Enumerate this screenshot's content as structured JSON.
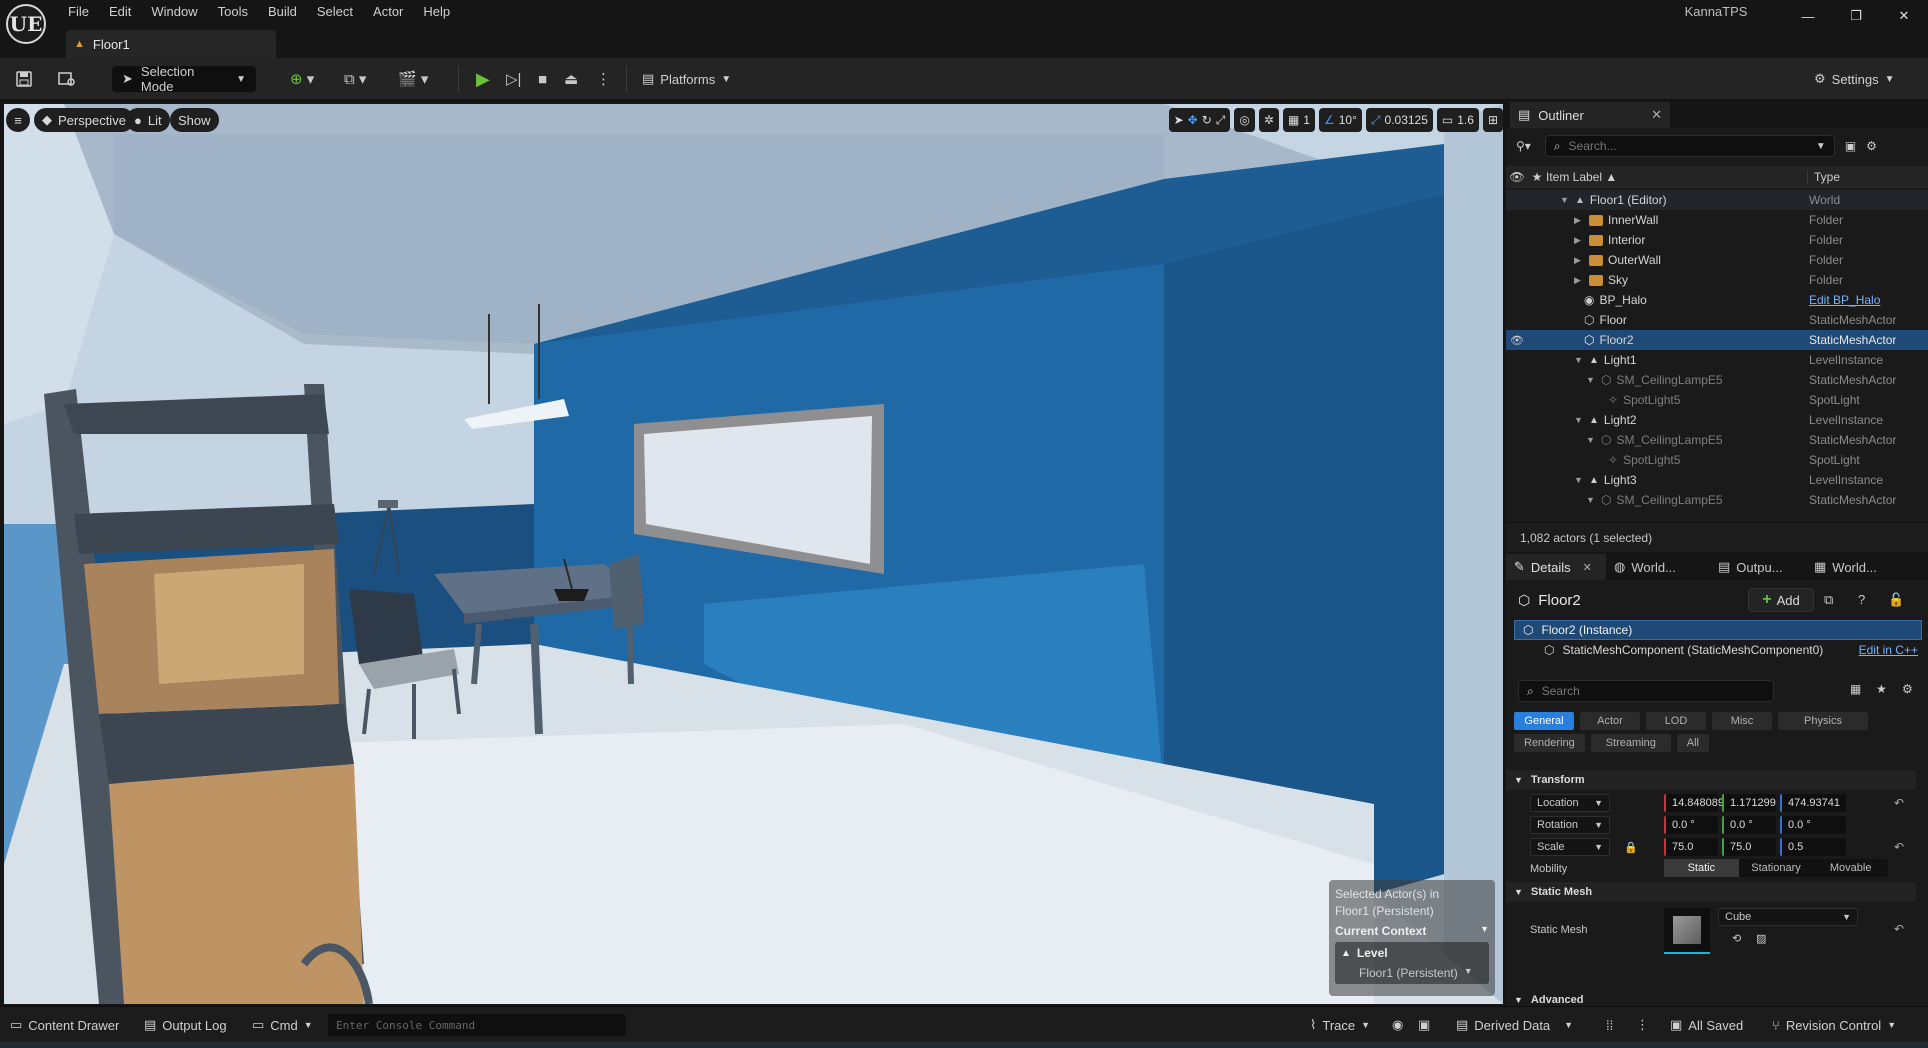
{
  "app": {
    "project_name": "KannaTPS",
    "logo": "UE",
    "doc_tab": "Floor1",
    "window_buttons": [
      "—",
      "❐",
      "✕"
    ]
  },
  "menu": [
    "File",
    "Edit",
    "Window",
    "Tools",
    "Build",
    "Select",
    "Actor",
    "Help"
  ],
  "toolbar": {
    "selection_mode": "Selection Mode",
    "platforms": "Platforms",
    "settings": "Settings"
  },
  "viewport": {
    "perspective": "Perspective",
    "lit": "Lit",
    "show": "Show",
    "grid_value": "1",
    "angle_value": "10°",
    "scale_value": "0.03125",
    "camera_speed": "1.6",
    "context": {
      "selected_text_1": "Selected Actor(s) in",
      "selected_text_2": "Floor1 (Persistent)",
      "title": "Current Context",
      "level_label": "Level",
      "level_name": "Floor1 (Persistent)"
    }
  },
  "outliner": {
    "tab_label": "Outliner",
    "search_placeholder": "Search...",
    "col_label": "Item Label ▲",
    "col_type": "Type",
    "rows": [
      {
        "label": "Floor1 (Editor)",
        "type": "World"
      },
      {
        "label": "InnerWall",
        "type": "Folder"
      },
      {
        "label": "Interior",
        "type": "Folder"
      },
      {
        "label": "OuterWall",
        "type": "Folder"
      },
      {
        "label": "Sky",
        "type": "Folder"
      },
      {
        "label": "BP_Halo",
        "type": "Edit BP_Halo"
      },
      {
        "label": "Floor",
        "type": "StaticMeshActor"
      },
      {
        "label": "Floor2",
        "type": "StaticMeshActor"
      },
      {
        "label": "Light1",
        "type": "LevelInstance"
      },
      {
        "label": "SM_CeilingLampE5",
        "type": "StaticMeshActor"
      },
      {
        "label": "SpotLight5",
        "type": "SpotLight"
      },
      {
        "label": "Light2",
        "type": "LevelInstance"
      },
      {
        "label": "SM_CeilingLampE5",
        "type": "StaticMeshActor"
      },
      {
        "label": "SpotLight5",
        "type": "SpotLight"
      },
      {
        "label": "Light3",
        "type": "LevelInstance"
      },
      {
        "label": "SM_CeilingLampE5",
        "type": "StaticMeshActor"
      }
    ],
    "footer": "1,082 actors (1 selected)"
  },
  "details": {
    "tabs": [
      "Details",
      "World...",
      "Outpu...",
      "World..."
    ],
    "actor_name": "Floor2",
    "add_label": "Add",
    "instance_label": "Floor2 (Instance)",
    "component_label": "StaticMeshComponent (StaticMeshComponent0)",
    "edit_in_cpp": "Edit in C++",
    "search_placeholder": "Search",
    "categories": [
      "General",
      "Actor",
      "LOD",
      "Misc",
      "Physics",
      "Rendering",
      "Streaming",
      "All"
    ],
    "transform_section": "Transform",
    "location_label": "Location",
    "location": [
      "14.848089",
      "1.171299",
      "474.93741"
    ],
    "rotation_label": "Rotation",
    "rotation": [
      "0.0 °",
      "0.0 °",
      "0.0 °"
    ],
    "scale_label": "Scale",
    "scale": [
      "75.0",
      "75.0",
      "0.5"
    ],
    "mobility_label": "Mobility",
    "mobility_options": [
      "Static",
      "Stationary",
      "Movable"
    ],
    "static_mesh_section": "Static Mesh",
    "static_mesh_label": "Static Mesh",
    "static_mesh_value": "Cube",
    "advanced_section": "Advanced"
  },
  "status": {
    "content_drawer": "Content Drawer",
    "output_log": "Output Log",
    "cmd": "Cmd",
    "console_placeholder": "Enter Console Command",
    "trace": "Trace",
    "derived_data": "Derived Data",
    "all_saved": "All Saved",
    "revision_control": "Revision Control"
  }
}
